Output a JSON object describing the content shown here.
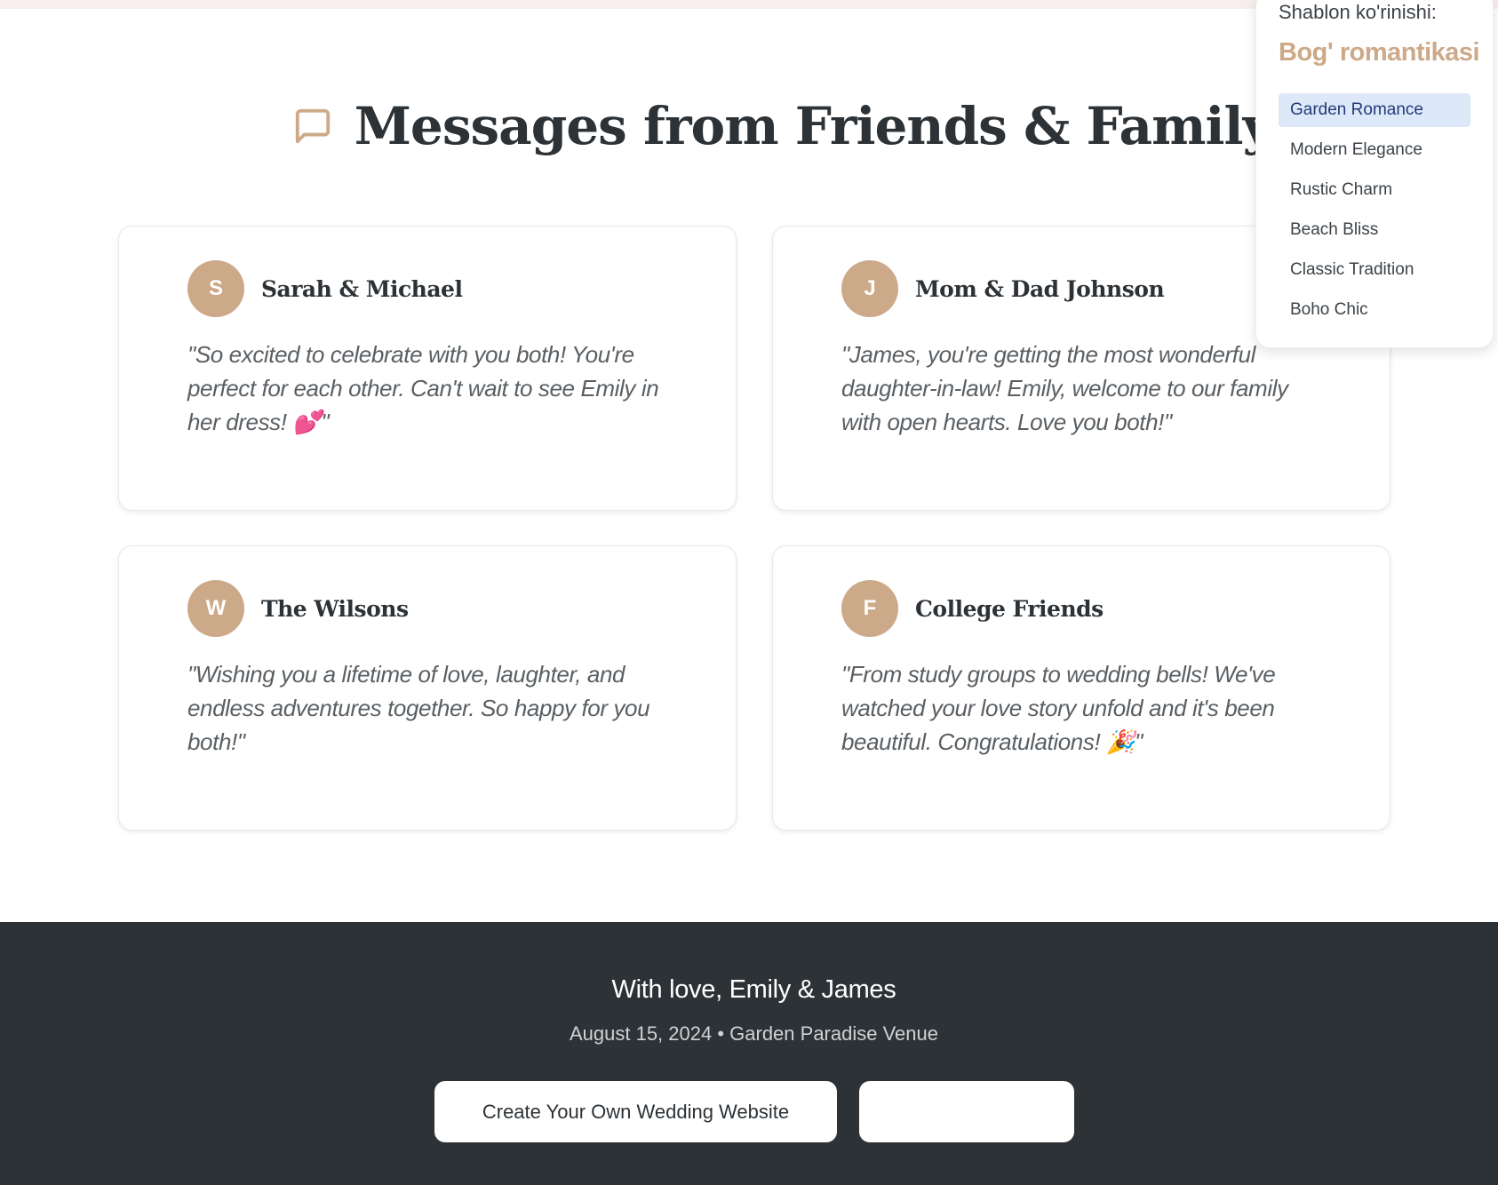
{
  "section": {
    "title": "Messages from Friends & Family",
    "icon": "message-square-icon",
    "accent_color": "#cca988"
  },
  "messages": [
    {
      "initial": "S",
      "author": "Sarah & Michael",
      "text": "\"So excited to celebrate with you both! You're perfect for each other. Can't wait to see Emily in her dress! 💕\""
    },
    {
      "initial": "J",
      "author": "Mom & Dad Johnson",
      "text": "\"James, you're getting the most wonderful daughter-in-law! Emily, welcome to our family with open hearts. Love you both!\""
    },
    {
      "initial": "W",
      "author": "The Wilsons",
      "text": "\"Wishing you a lifetime of love, laughter, and endless adventures together. So happy for you both!\""
    },
    {
      "initial": "F",
      "author": "College Friends",
      "text": "\"From study groups to wedding bells! We've watched your love story unfold and it's been beautiful. Congratulations! 🎉\""
    }
  ],
  "footer": {
    "signature": "With love, Emily & James",
    "info": "August 15, 2024 • Garden Paradise Venue",
    "create_button": "Create Your Own Wedding Website",
    "second_button": "",
    "background_color": "#2d3236"
  },
  "template_picker": {
    "label": "Shablon ko'rinishi:",
    "current": "Bog' romantikasi",
    "options": [
      "Garden Romance",
      "Modern Elegance",
      "Rustic Charm",
      "Beach Bliss",
      "Classic Tradition",
      "Boho Chic"
    ],
    "selected": "Garden Romance"
  }
}
